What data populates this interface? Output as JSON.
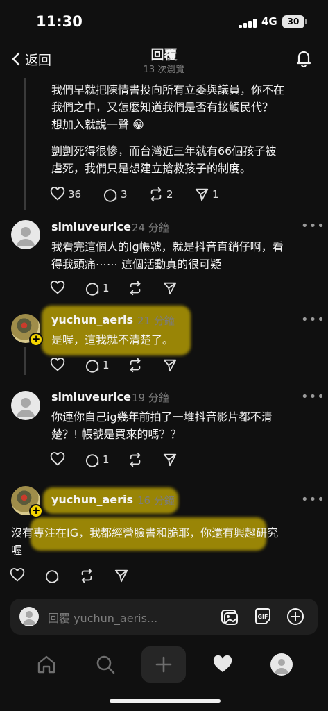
{
  "status_bar": {
    "time": "11:30",
    "network": "4G",
    "battery": "30"
  },
  "header": {
    "back_label": "返回",
    "title": "回覆",
    "views": "13 次瀏覽"
  },
  "top_post": {
    "paragraph1": [
      "我們早就把陳情書投向所有立委與議員，你不在",
      "我們之中，又怎麼知道我們是否有接觸民代？",
      "想加入就說一聲 😁"
    ],
    "paragraph2": [
      "剴剴死得很慘，而台灣近三年就有66個孩子被",
      "虐死，我們只是想建立搶救孩子的制度。"
    ],
    "likes": "36",
    "replies": "3",
    "reposts": "2",
    "shares": "1"
  },
  "comments": [
    {
      "username": "simluveurice",
      "time": "24 分鐘",
      "lines": [
        "我看完這個人的ig帳號，就是抖音直銷仔啊，看",
        "得我頭痛⋯⋯ 這個活動真的很可疑"
      ],
      "replies": "1"
    },
    {
      "username": "yuchun_aeris",
      "time": "21 分鐘",
      "lines": [
        "是喔，這我就不清楚了。"
      ],
      "replies": "1"
    },
    {
      "username": "simluveurice",
      "time": "19 分鐘",
      "lines": [
        "你連你自己ig幾年前拍了一堆抖音影片都不清",
        "楚？! 帳號是買來的嗎？？"
      ],
      "replies": "1"
    },
    {
      "username": "yuchun_aeris",
      "time": "16 分鐘",
      "lines": [
        "沒有專注在IG，我都經營臉書和脆耶，你還有興趣研究",
        "喔"
      ]
    }
  ],
  "reply_bar": {
    "placeholder": "回覆 yuchun_aeris..."
  },
  "icons": {
    "more": "•••",
    "plus": "+"
  },
  "colors": {
    "background": "#101010",
    "highlight": "#f5d400",
    "muted": "#7d7d7d"
  }
}
